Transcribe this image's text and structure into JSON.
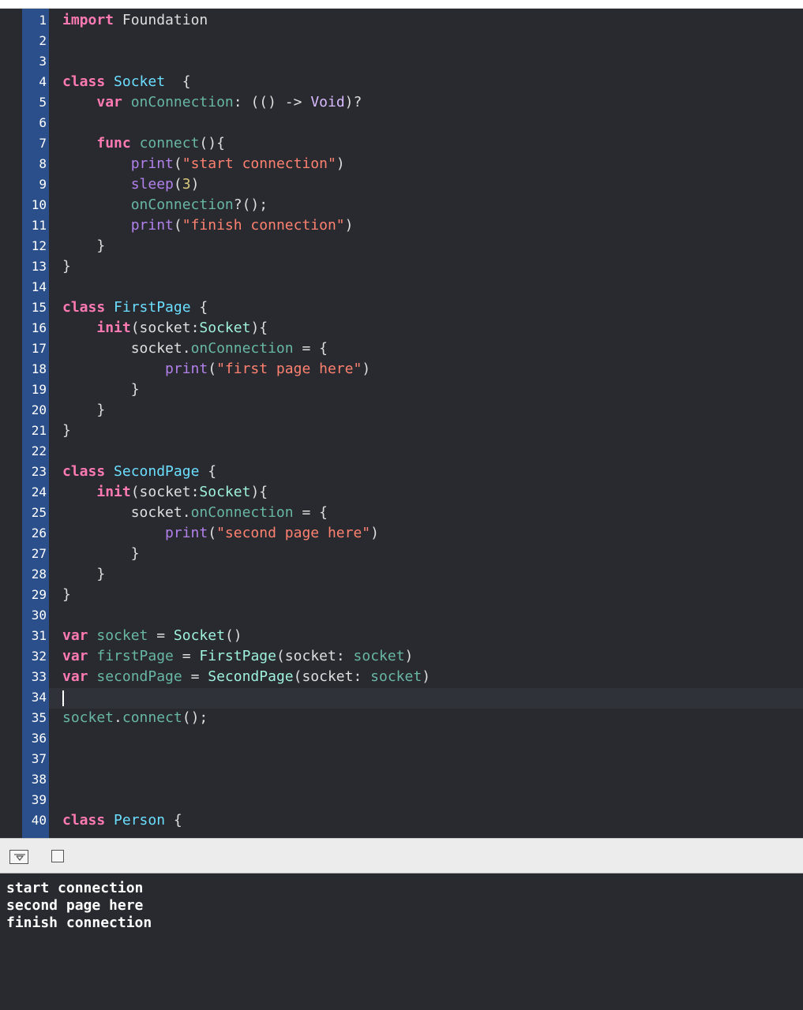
{
  "editor": {
    "line_numbers": [
      "1",
      "2",
      "3",
      "4",
      "5",
      "6",
      "7",
      "8",
      "9",
      "10",
      "11",
      "12",
      "13",
      "14",
      "15",
      "16",
      "17",
      "18",
      "19",
      "20",
      "21",
      "22",
      "23",
      "24",
      "25",
      "26",
      "27",
      "28",
      "29",
      "30",
      "31",
      "32",
      "33",
      "34",
      "35",
      "36",
      "37",
      "38",
      "39",
      "40"
    ],
    "lines": [
      [
        {
          "t": "import",
          "c": "kw"
        },
        {
          "t": " Foundation",
          "c": "dt"
        }
      ],
      [],
      [],
      [
        {
          "t": "class",
          "c": "kw"
        },
        {
          "t": " ",
          "c": "dt"
        },
        {
          "t": "Socket",
          "c": "ty"
        },
        {
          "t": "  {",
          "c": "dt"
        }
      ],
      [
        {
          "t": "    ",
          "c": "dt"
        },
        {
          "t": "var",
          "c": "kw"
        },
        {
          "t": " ",
          "c": "dt"
        },
        {
          "t": "onConnection",
          "c": "pr"
        },
        {
          "t": ": (() -> ",
          "c": "dt"
        },
        {
          "t": "Void",
          "c": "tp"
        },
        {
          "t": ")?",
          "c": "dt"
        }
      ],
      [],
      [
        {
          "t": "    ",
          "c": "dt"
        },
        {
          "t": "func",
          "c": "kw"
        },
        {
          "t": " ",
          "c": "dt"
        },
        {
          "t": "connect",
          "c": "pr"
        },
        {
          "t": "(){",
          "c": "dt"
        }
      ],
      [
        {
          "t": "        ",
          "c": "dt"
        },
        {
          "t": "print",
          "c": "fn"
        },
        {
          "t": "(",
          "c": "dt"
        },
        {
          "t": "\"start connection\"",
          "c": "st"
        },
        {
          "t": ")",
          "c": "dt"
        }
      ],
      [
        {
          "t": "        ",
          "c": "dt"
        },
        {
          "t": "sleep",
          "c": "fn"
        },
        {
          "t": "(",
          "c": "dt"
        },
        {
          "t": "3",
          "c": "nm"
        },
        {
          "t": ")",
          "c": "dt"
        }
      ],
      [
        {
          "t": "        ",
          "c": "dt"
        },
        {
          "t": "onConnection",
          "c": "pr"
        },
        {
          "t": "?();",
          "c": "dt"
        }
      ],
      [
        {
          "t": "        ",
          "c": "dt"
        },
        {
          "t": "print",
          "c": "fn"
        },
        {
          "t": "(",
          "c": "dt"
        },
        {
          "t": "\"finish connection\"",
          "c": "st"
        },
        {
          "t": ")",
          "c": "dt"
        }
      ],
      [
        {
          "t": "    }",
          "c": "dt"
        }
      ],
      [
        {
          "t": "}",
          "c": "dt"
        }
      ],
      [],
      [
        {
          "t": "class",
          "c": "kw"
        },
        {
          "t": " ",
          "c": "dt"
        },
        {
          "t": "FirstPage",
          "c": "ty"
        },
        {
          "t": " {",
          "c": "dt"
        }
      ],
      [
        {
          "t": "    ",
          "c": "dt"
        },
        {
          "t": "init",
          "c": "kw"
        },
        {
          "t": "(socket:",
          "c": "dt"
        },
        {
          "t": "Socket",
          "c": "cl"
        },
        {
          "t": "){",
          "c": "dt"
        }
      ],
      [
        {
          "t": "        socket.",
          "c": "dt"
        },
        {
          "t": "onConnection",
          "c": "pr"
        },
        {
          "t": " = {",
          "c": "dt"
        }
      ],
      [
        {
          "t": "            ",
          "c": "dt"
        },
        {
          "t": "print",
          "c": "fn"
        },
        {
          "t": "(",
          "c": "dt"
        },
        {
          "t": "\"first page here\"",
          "c": "st"
        },
        {
          "t": ")",
          "c": "dt"
        }
      ],
      [
        {
          "t": "        }",
          "c": "dt"
        }
      ],
      [
        {
          "t": "    }",
          "c": "dt"
        }
      ],
      [
        {
          "t": "}",
          "c": "dt"
        }
      ],
      [],
      [
        {
          "t": "class",
          "c": "kw"
        },
        {
          "t": " ",
          "c": "dt"
        },
        {
          "t": "SecondPage",
          "c": "ty"
        },
        {
          "t": " {",
          "c": "dt"
        }
      ],
      [
        {
          "t": "    ",
          "c": "dt"
        },
        {
          "t": "init",
          "c": "kw"
        },
        {
          "t": "(socket:",
          "c": "dt"
        },
        {
          "t": "Socket",
          "c": "cl"
        },
        {
          "t": "){",
          "c": "dt"
        }
      ],
      [
        {
          "t": "        socket.",
          "c": "dt"
        },
        {
          "t": "onConnection",
          "c": "pr"
        },
        {
          "t": " = {",
          "c": "dt"
        }
      ],
      [
        {
          "t": "            ",
          "c": "dt"
        },
        {
          "t": "print",
          "c": "fn"
        },
        {
          "t": "(",
          "c": "dt"
        },
        {
          "t": "\"second page here\"",
          "c": "st"
        },
        {
          "t": ")",
          "c": "dt"
        }
      ],
      [
        {
          "t": "        }",
          "c": "dt"
        }
      ],
      [
        {
          "t": "    }",
          "c": "dt"
        }
      ],
      [
        {
          "t": "}",
          "c": "dt"
        }
      ],
      [],
      [
        {
          "t": "var",
          "c": "kw"
        },
        {
          "t": " ",
          "c": "dt"
        },
        {
          "t": "socket",
          "c": "pr"
        },
        {
          "t": " = ",
          "c": "dt"
        },
        {
          "t": "Socket",
          "c": "cl"
        },
        {
          "t": "()",
          "c": "dt"
        }
      ],
      [
        {
          "t": "var",
          "c": "kw"
        },
        {
          "t": " ",
          "c": "dt"
        },
        {
          "t": "firstPage",
          "c": "pr"
        },
        {
          "t": " = ",
          "c": "dt"
        },
        {
          "t": "FirstPage",
          "c": "cl"
        },
        {
          "t": "(socket: ",
          "c": "dt"
        },
        {
          "t": "socket",
          "c": "pr"
        },
        {
          "t": ")",
          "c": "dt"
        }
      ],
      [
        {
          "t": "var",
          "c": "kw"
        },
        {
          "t": " ",
          "c": "dt"
        },
        {
          "t": "secondPage",
          "c": "pr"
        },
        {
          "t": " = ",
          "c": "dt"
        },
        {
          "t": "SecondPage",
          "c": "cl"
        },
        {
          "t": "(socket: ",
          "c": "dt"
        },
        {
          "t": "socket",
          "c": "pr"
        },
        {
          "t": ")",
          "c": "dt"
        }
      ],
      [],
      [
        {
          "t": "socket",
          "c": "pr"
        },
        {
          "t": ".",
          "c": "dt"
        },
        {
          "t": "connect",
          "c": "pr"
        },
        {
          "t": "();",
          "c": "dt"
        }
      ],
      [],
      [],
      [],
      [],
      [
        {
          "t": "class",
          "c": "kw"
        },
        {
          "t": " ",
          "c": "dt"
        },
        {
          "t": "Person",
          "c": "ty"
        },
        {
          "t": " {",
          "c": "dt"
        }
      ]
    ],
    "current_line": 34
  },
  "debug_toolbar": {
    "hide_icon": "chevron-down-in-box-icon",
    "breakpoint_icon": "empty-square-icon"
  },
  "console": {
    "lines": [
      "start connection",
      "second page here",
      "finish connection"
    ]
  },
  "colors": {
    "keyword": "#ff7ab2",
    "type_declaration": "#6bdfff",
    "property": "#67b7a4",
    "function": "#b281eb",
    "string": "#ff8170",
    "number": "#d9c97c",
    "background": "#292a30"
  }
}
